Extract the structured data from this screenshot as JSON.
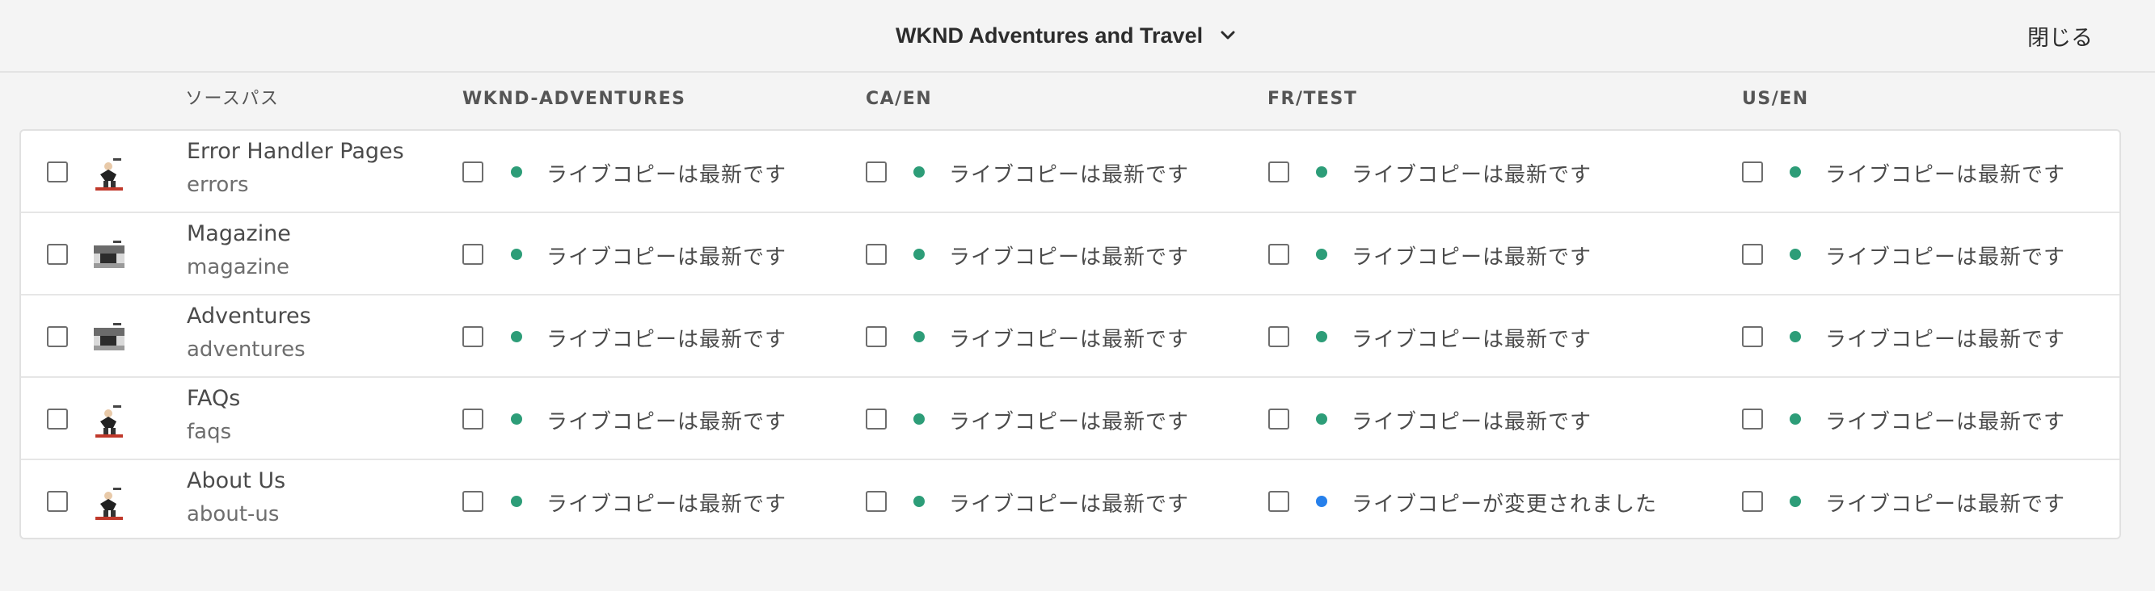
{
  "header": {
    "site_name": "WKND Adventures and Travel",
    "close_label": "閉じる"
  },
  "columns": {
    "source": "ソースパス",
    "targets": [
      "WKND-ADVENTURES",
      "CA/EN",
      "FR/TEST",
      "US/EN"
    ]
  },
  "status_colors": {
    "up_to_date": "#2d9d78",
    "modified": "#2680eb"
  },
  "rows": [
    {
      "title": "Error Handler Pages",
      "path": "errors",
      "thumb": "skater-thumbnail",
      "statuses": [
        {
          "text": "ライブコピーは最新です",
          "state": "up_to_date"
        },
        {
          "text": "ライブコピーは最新です",
          "state": "up_to_date"
        },
        {
          "text": "ライブコピーは最新です",
          "state": "up_to_date"
        },
        {
          "text": "ライブコピーは最新です",
          "state": "up_to_date"
        }
      ]
    },
    {
      "title": "Magazine",
      "path": "magazine",
      "thumb": "landscape-thumbnail",
      "statuses": [
        {
          "text": "ライブコピーは最新です",
          "state": "up_to_date"
        },
        {
          "text": "ライブコピーは最新です",
          "state": "up_to_date"
        },
        {
          "text": "ライブコピーは最新です",
          "state": "up_to_date"
        },
        {
          "text": "ライブコピーは最新です",
          "state": "up_to_date"
        }
      ]
    },
    {
      "title": "Adventures",
      "path": "adventures",
      "thumb": "landscape-thumbnail",
      "statuses": [
        {
          "text": "ライブコピーは最新です",
          "state": "up_to_date"
        },
        {
          "text": "ライブコピーは最新です",
          "state": "up_to_date"
        },
        {
          "text": "ライブコピーは最新です",
          "state": "up_to_date"
        },
        {
          "text": "ライブコピーは最新です",
          "state": "up_to_date"
        }
      ]
    },
    {
      "title": "FAQs",
      "path": "faqs",
      "thumb": "skater-thumbnail",
      "statuses": [
        {
          "text": "ライブコピーは最新です",
          "state": "up_to_date"
        },
        {
          "text": "ライブコピーは最新です",
          "state": "up_to_date"
        },
        {
          "text": "ライブコピーは最新です",
          "state": "up_to_date"
        },
        {
          "text": "ライブコピーは最新です",
          "state": "up_to_date"
        }
      ]
    },
    {
      "title": "About Us",
      "path": "about-us",
      "thumb": "skater-thumbnail",
      "statuses": [
        {
          "text": "ライブコピーは最新です",
          "state": "up_to_date"
        },
        {
          "text": "ライブコピーは最新です",
          "state": "up_to_date"
        },
        {
          "text": "ライブコピーが変更されました",
          "state": "modified"
        },
        {
          "text": "ライブコピーは最新です",
          "state": "up_to_date"
        }
      ]
    }
  ]
}
